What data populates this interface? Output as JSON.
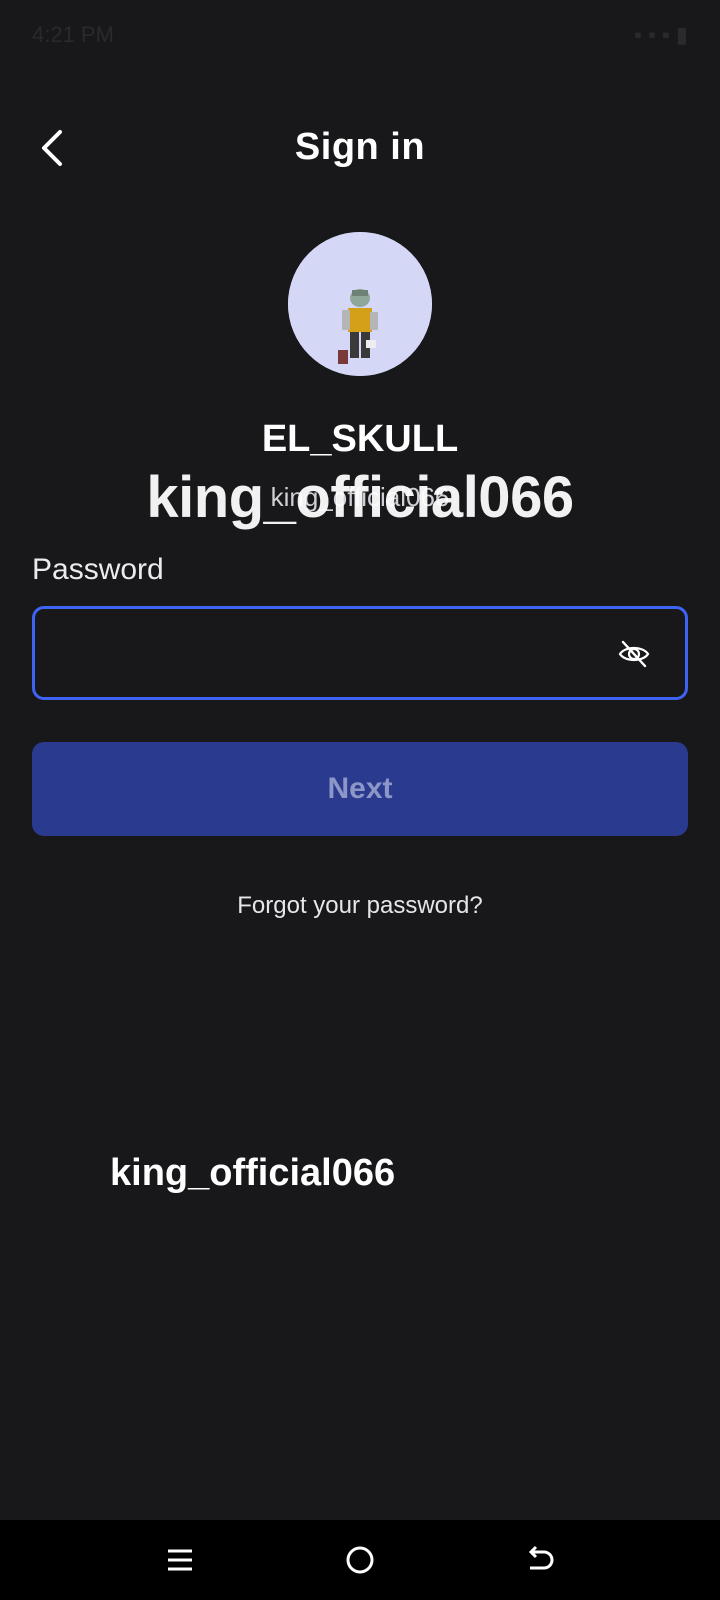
{
  "status_bar": {
    "time": "4:21 PM",
    "icons": "▪ ▪ ▪ ▮"
  },
  "header": {
    "title": "Sign in",
    "back_icon": "chevron-left-icon"
  },
  "profile": {
    "display_name": "EL_SKULL",
    "username": "king_official066",
    "avatar_bg": "#d5d7f7"
  },
  "overlay": {
    "watermark_large": "king_official066",
    "watermark_bottom": "king_official066"
  },
  "form": {
    "password_label": "Password",
    "password_value": "",
    "visibility_icon": "eye-off-icon",
    "field_border_color": "#3f63f2"
  },
  "actions": {
    "next_label": "Next",
    "next_bg": "#2a3a8f",
    "forgot_label": "Forgot your password?"
  },
  "nav_bar": {
    "menu_icon": "menu-icon",
    "home_icon": "home-circle-icon",
    "back_icon": "back-arrow-icon"
  }
}
